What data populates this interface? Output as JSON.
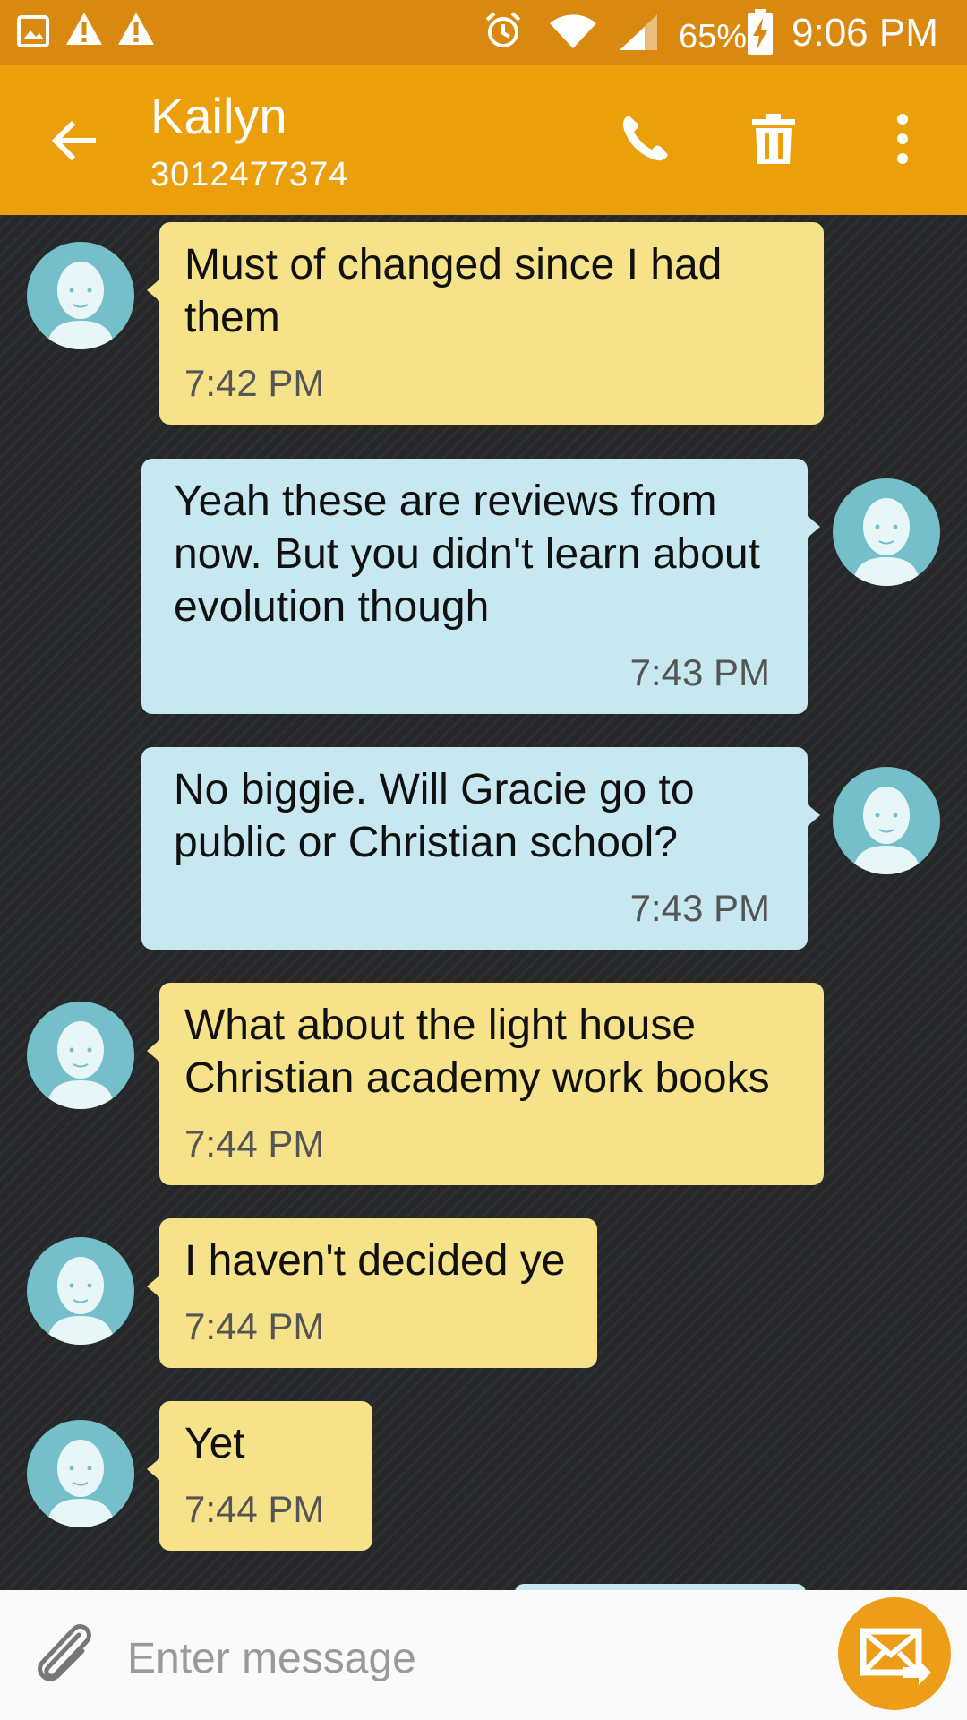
{
  "status_bar": {
    "battery": "65%",
    "time": "9:06 PM",
    "icons": [
      "gallery-icon",
      "warning-icon",
      "warning-icon",
      "alarm-icon",
      "wifi-icon",
      "signal-icon",
      "battery-charging-icon"
    ]
  },
  "app_bar": {
    "title": "Kailyn",
    "subtitle": "3012477374",
    "icons": [
      "back-arrow-icon",
      "phone-icon",
      "trash-icon",
      "more-vert-icon"
    ]
  },
  "messages": [
    {
      "direction": "in",
      "text": "Must of changed since I had them",
      "time": "7:42 PM"
    },
    {
      "direction": "out",
      "text": "Yeah these are reviews from now. But you didn't learn about evolution though",
      "time": "7:43 PM"
    },
    {
      "direction": "out",
      "text": "No biggie. Will Gracie go to public or Christian school?",
      "time": "7:43 PM"
    },
    {
      "direction": "in",
      "text": "What about the light house Christian academy work books",
      "time": "7:44 PM"
    },
    {
      "direction": "in",
      "text": "I haven't decided ye",
      "time": "7:44 PM"
    },
    {
      "direction": "in",
      "text": "Yet",
      "time": "7:44 PM"
    }
  ],
  "composer": {
    "placeholder": "Enter message",
    "value": "",
    "icons": [
      "attach-icon",
      "send-icon"
    ]
  },
  "colors": {
    "status_bar": "#d98810",
    "app_bar": "#eba00b",
    "incoming_bubble": "#f5e289",
    "outgoing_bubble": "#c8e8f1",
    "avatar": "#74bfc9",
    "send_button": "#ee9d18",
    "background": "#262729"
  }
}
